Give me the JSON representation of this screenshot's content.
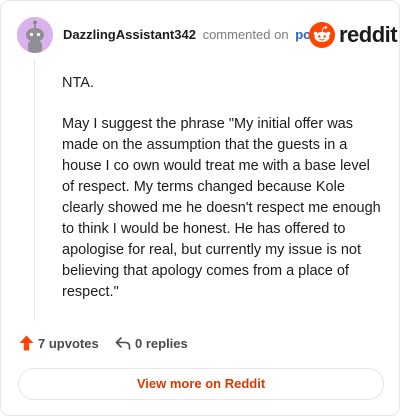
{
  "header": {
    "username": "DazzlingAssistant342",
    "action_text": "commented on",
    "post_link": "post",
    "brand_word": "reddit",
    "brand_icon": "reddit-alien-icon"
  },
  "comment": {
    "paragraphs": [
      "NTA.",
      "May I suggest the phrase \"My initial offer was made on the assumption that the guests in a house I co own would treat me with a base level of respect. My terms changed because Kole clearly showed me he doesn't respect me enough to think I would be honest. He has offered to apologise for real, but currently my issue is not believing that apology comes from a place of respect.\""
    ]
  },
  "actions": {
    "upvotes_label": "7 upvotes",
    "replies_label": "0 replies"
  },
  "footer": {
    "view_more_label": "View more on Reddit"
  },
  "colors": {
    "accent": "#ff4500",
    "link": "#2563c9",
    "view_more_text": "#d93a00",
    "avatar_bg": "#d9b3ee"
  }
}
